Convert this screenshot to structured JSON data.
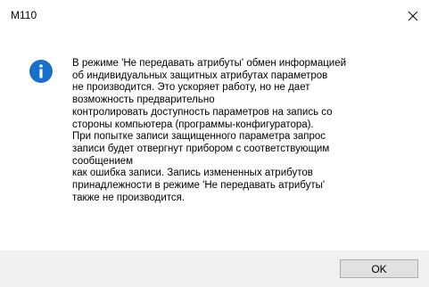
{
  "window": {
    "title": "M110"
  },
  "icons": {
    "close": "close-icon",
    "info": "info-icon"
  },
  "colors": {
    "info_icon": "#1a6fc9",
    "footer_bg": "#f0f0f0",
    "button_bg": "#e1e1e1",
    "button_border": "#adadad"
  },
  "message": {
    "text": "В режиме 'Не передавать атрибуты' обмен информацией\nоб индивидуальных защитных атрибутах параметров\nне производится. Это ускоряет работу, но не дает\nвозможность предварительно\nконтролировать доступность параметров на запись со\nстороны компьютера (программы-конфигуратора).\nПри попытке записи защищенного параметра запрос\nзаписи будет отвергнут прибором с соответствующим\nсообщением\nкак ошибка записи. Запись измененных атрибутов\nпринадлежности в режиме 'Не передавать атрибуты'\nтакже не производится."
  },
  "buttons": {
    "ok_label": "OK"
  }
}
